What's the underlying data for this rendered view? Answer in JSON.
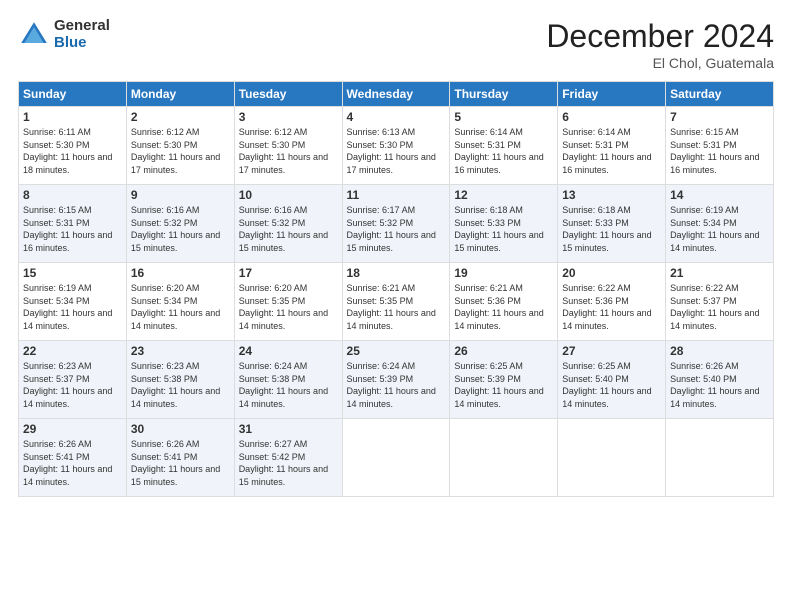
{
  "logo": {
    "general": "General",
    "blue": "Blue"
  },
  "header": {
    "title": "December 2024",
    "subtitle": "El Chol, Guatemala"
  },
  "days_of_week": [
    "Sunday",
    "Monday",
    "Tuesday",
    "Wednesday",
    "Thursday",
    "Friday",
    "Saturday"
  ],
  "weeks": [
    [
      {
        "day": "1",
        "sunrise": "Sunrise: 6:11 AM",
        "sunset": "Sunset: 5:30 PM",
        "daylight": "Daylight: 11 hours and 18 minutes."
      },
      {
        "day": "2",
        "sunrise": "Sunrise: 6:12 AM",
        "sunset": "Sunset: 5:30 PM",
        "daylight": "Daylight: 11 hours and 17 minutes."
      },
      {
        "day": "3",
        "sunrise": "Sunrise: 6:12 AM",
        "sunset": "Sunset: 5:30 PM",
        "daylight": "Daylight: 11 hours and 17 minutes."
      },
      {
        "day": "4",
        "sunrise": "Sunrise: 6:13 AM",
        "sunset": "Sunset: 5:30 PM",
        "daylight": "Daylight: 11 hours and 17 minutes."
      },
      {
        "day": "5",
        "sunrise": "Sunrise: 6:14 AM",
        "sunset": "Sunset: 5:31 PM",
        "daylight": "Daylight: 11 hours and 16 minutes."
      },
      {
        "day": "6",
        "sunrise": "Sunrise: 6:14 AM",
        "sunset": "Sunset: 5:31 PM",
        "daylight": "Daylight: 11 hours and 16 minutes."
      },
      {
        "day": "7",
        "sunrise": "Sunrise: 6:15 AM",
        "sunset": "Sunset: 5:31 PM",
        "daylight": "Daylight: 11 hours and 16 minutes."
      }
    ],
    [
      {
        "day": "8",
        "sunrise": "Sunrise: 6:15 AM",
        "sunset": "Sunset: 5:31 PM",
        "daylight": "Daylight: 11 hours and 16 minutes."
      },
      {
        "day": "9",
        "sunrise": "Sunrise: 6:16 AM",
        "sunset": "Sunset: 5:32 PM",
        "daylight": "Daylight: 11 hours and 15 minutes."
      },
      {
        "day": "10",
        "sunrise": "Sunrise: 6:16 AM",
        "sunset": "Sunset: 5:32 PM",
        "daylight": "Daylight: 11 hours and 15 minutes."
      },
      {
        "day": "11",
        "sunrise": "Sunrise: 6:17 AM",
        "sunset": "Sunset: 5:32 PM",
        "daylight": "Daylight: 11 hours and 15 minutes."
      },
      {
        "day": "12",
        "sunrise": "Sunrise: 6:18 AM",
        "sunset": "Sunset: 5:33 PM",
        "daylight": "Daylight: 11 hours and 15 minutes."
      },
      {
        "day": "13",
        "sunrise": "Sunrise: 6:18 AM",
        "sunset": "Sunset: 5:33 PM",
        "daylight": "Daylight: 11 hours and 15 minutes."
      },
      {
        "day": "14",
        "sunrise": "Sunrise: 6:19 AM",
        "sunset": "Sunset: 5:34 PM",
        "daylight": "Daylight: 11 hours and 14 minutes."
      }
    ],
    [
      {
        "day": "15",
        "sunrise": "Sunrise: 6:19 AM",
        "sunset": "Sunset: 5:34 PM",
        "daylight": "Daylight: 11 hours and 14 minutes."
      },
      {
        "day": "16",
        "sunrise": "Sunrise: 6:20 AM",
        "sunset": "Sunset: 5:34 PM",
        "daylight": "Daylight: 11 hours and 14 minutes."
      },
      {
        "day": "17",
        "sunrise": "Sunrise: 6:20 AM",
        "sunset": "Sunset: 5:35 PM",
        "daylight": "Daylight: 11 hours and 14 minutes."
      },
      {
        "day": "18",
        "sunrise": "Sunrise: 6:21 AM",
        "sunset": "Sunset: 5:35 PM",
        "daylight": "Daylight: 11 hours and 14 minutes."
      },
      {
        "day": "19",
        "sunrise": "Sunrise: 6:21 AM",
        "sunset": "Sunset: 5:36 PM",
        "daylight": "Daylight: 11 hours and 14 minutes."
      },
      {
        "day": "20",
        "sunrise": "Sunrise: 6:22 AM",
        "sunset": "Sunset: 5:36 PM",
        "daylight": "Daylight: 11 hours and 14 minutes."
      },
      {
        "day": "21",
        "sunrise": "Sunrise: 6:22 AM",
        "sunset": "Sunset: 5:37 PM",
        "daylight": "Daylight: 11 hours and 14 minutes."
      }
    ],
    [
      {
        "day": "22",
        "sunrise": "Sunrise: 6:23 AM",
        "sunset": "Sunset: 5:37 PM",
        "daylight": "Daylight: 11 hours and 14 minutes."
      },
      {
        "day": "23",
        "sunrise": "Sunrise: 6:23 AM",
        "sunset": "Sunset: 5:38 PM",
        "daylight": "Daylight: 11 hours and 14 minutes."
      },
      {
        "day": "24",
        "sunrise": "Sunrise: 6:24 AM",
        "sunset": "Sunset: 5:38 PM",
        "daylight": "Daylight: 11 hours and 14 minutes."
      },
      {
        "day": "25",
        "sunrise": "Sunrise: 6:24 AM",
        "sunset": "Sunset: 5:39 PM",
        "daylight": "Daylight: 11 hours and 14 minutes."
      },
      {
        "day": "26",
        "sunrise": "Sunrise: 6:25 AM",
        "sunset": "Sunset: 5:39 PM",
        "daylight": "Daylight: 11 hours and 14 minutes."
      },
      {
        "day": "27",
        "sunrise": "Sunrise: 6:25 AM",
        "sunset": "Sunset: 5:40 PM",
        "daylight": "Daylight: 11 hours and 14 minutes."
      },
      {
        "day": "28",
        "sunrise": "Sunrise: 6:26 AM",
        "sunset": "Sunset: 5:40 PM",
        "daylight": "Daylight: 11 hours and 14 minutes."
      }
    ],
    [
      {
        "day": "29",
        "sunrise": "Sunrise: 6:26 AM",
        "sunset": "Sunset: 5:41 PM",
        "daylight": "Daylight: 11 hours and 14 minutes."
      },
      {
        "day": "30",
        "sunrise": "Sunrise: 6:26 AM",
        "sunset": "Sunset: 5:41 PM",
        "daylight": "Daylight: 11 hours and 15 minutes."
      },
      {
        "day": "31",
        "sunrise": "Sunrise: 6:27 AM",
        "sunset": "Sunset: 5:42 PM",
        "daylight": "Daylight: 11 hours and 15 minutes."
      },
      null,
      null,
      null,
      null
    ]
  ]
}
